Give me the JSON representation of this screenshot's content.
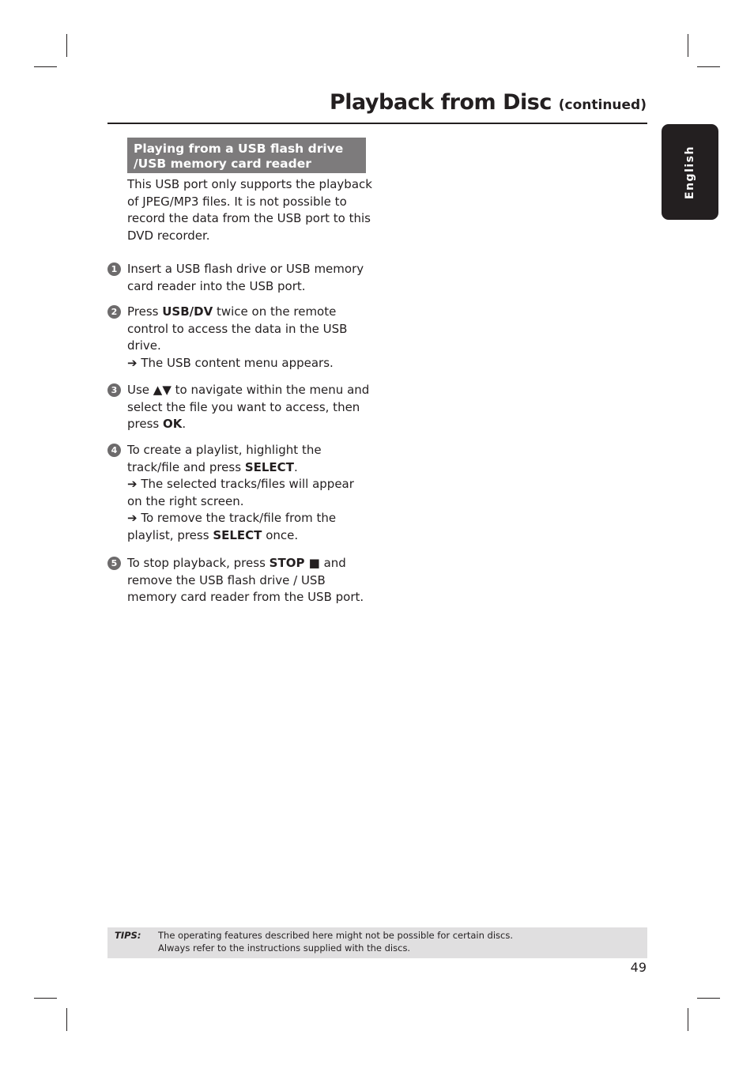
{
  "header": {
    "title": "Playback from Disc",
    "title_suffix": "(continued)",
    "language_tab": "English"
  },
  "section": {
    "heading_line1": "Playing from a USB flash drive",
    "heading_line2": "/USB memory card reader",
    "intro": "This USB port only supports the playback of JPEG/MP3 files. It is not possible to record the data from the USB port to this DVD recorder."
  },
  "steps": [
    {
      "num": "1",
      "parts": [
        {
          "t": "Insert a USB flash drive or USB memory card reader into the USB port."
        }
      ]
    },
    {
      "num": "2",
      "parts": [
        {
          "t": "Press "
        },
        {
          "b": "USB/DV"
        },
        {
          "t": " twice on the remote control to access the data in the USB drive."
        },
        {
          "br": true
        },
        {
          "t": "➔ The USB content menu appears."
        }
      ]
    },
    {
      "num": "3",
      "parts": [
        {
          "t": "Use ▲▼ to navigate within the menu and select the file you want to access, then press "
        },
        {
          "b": "OK"
        },
        {
          "t": "."
        }
      ]
    },
    {
      "num": "4",
      "parts": [
        {
          "t": "To create a playlist, highlight the track/file and press "
        },
        {
          "b": "SELECT"
        },
        {
          "t": "."
        },
        {
          "br": true
        },
        {
          "t": "➔ The selected tracks/files will appear on the right screen."
        },
        {
          "br": true
        },
        {
          "t": "➔ To remove the track/file from the playlist, press "
        },
        {
          "b": "SELECT"
        },
        {
          "t": " once."
        }
      ]
    },
    {
      "num": "5",
      "parts": [
        {
          "t": "To stop playback, press "
        },
        {
          "b": "STOP ■"
        },
        {
          "t": " and remove the USB flash drive / USB memory card reader from the USB port."
        }
      ]
    }
  ],
  "tips": {
    "label": "TIPS:",
    "line1": "The operating features described here might not be possible for certain discs.",
    "line2": "Always refer to the instructions supplied with the discs."
  },
  "page_number": "49"
}
